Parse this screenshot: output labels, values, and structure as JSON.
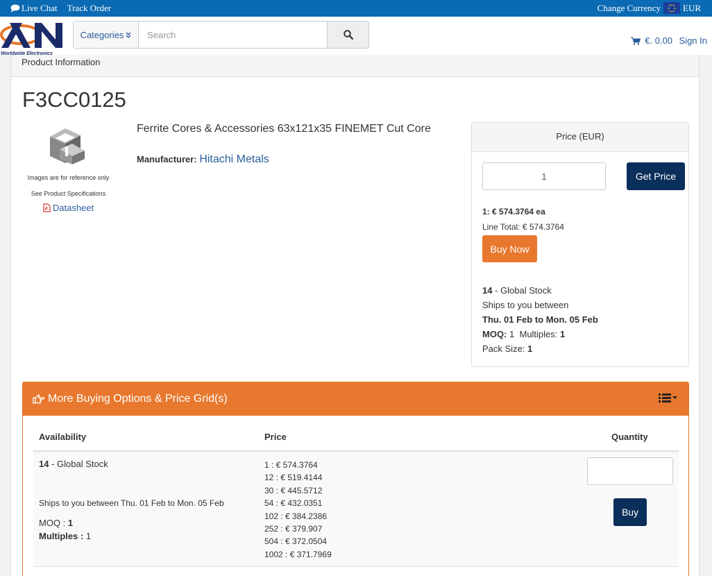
{
  "topbar": {
    "live_chat": "Live Chat",
    "track_order": "Track Order",
    "change_currency": "Change Currency",
    "currency": "EUR"
  },
  "header": {
    "logo_tagline": "Worldwide Electronics",
    "categories_label": "Categories",
    "search_placeholder": "Search",
    "cart_total": "€. 0.00",
    "sign_in": "Sign In"
  },
  "product": {
    "panel_heading": "Product Information",
    "part_number": "F3CC0125",
    "image_note": "Images are for reference only",
    "spec_note": "See Product Specifications",
    "datasheet": "Datasheet",
    "description": "Ferrite Cores & Accessories 63x121x35 FINEMET Cut Core",
    "manufacturer_label": "Manufacturer:",
    "manufacturer": "Hitachi Metals"
  },
  "pricebox": {
    "heading": "Price (EUR)",
    "quantity": "1",
    "get_price": "Get Price",
    "unit_price_label": "1:",
    "unit_price": "€ 574.3764 ea",
    "line_total_label": "Line Total:",
    "line_total": "€ 574.3764",
    "buy_now": "Buy Now",
    "stock_count": "14",
    "stock_text": "- Global Stock",
    "ships_between": "Ships to you between",
    "ship_dates": "Thu. 01 Feb to Mon. 05 Feb",
    "moq_label": "MOQ:",
    "moq": "1",
    "multiples_label": "Multiples:",
    "multiples": "1",
    "pack_label": "Pack Size:",
    "pack": "1"
  },
  "options": {
    "heading": "More Buying Options & Price Grid(s)",
    "col_availability": "Availability",
    "col_price": "Price",
    "col_quantity": "Quantity",
    "row": {
      "stock_count": "14",
      "stock_text": "- Global Stock",
      "ships": "Ships to you between Thu. 01 Feb to Mon. 05 Feb",
      "moq_label": "MOQ :",
      "moq": "1",
      "multiples_label": "Multiples :",
      "multiples": "1",
      "tiers": [
        "1 : € 574.3764",
        "12 : € 519.4144",
        "30 : € 445.5712",
        "54 : € 432.0351",
        "102 : € 384.2386",
        "252 : € 379.907",
        "504 : € 372.0504",
        "1002 : € 371.7969"
      ],
      "buy": "Buy"
    }
  },
  "colors": {
    "topbar": "#0a6ab3",
    "navy": "#0b2f5b",
    "orange": "#e8782d",
    "link": "#2a5d9b"
  }
}
